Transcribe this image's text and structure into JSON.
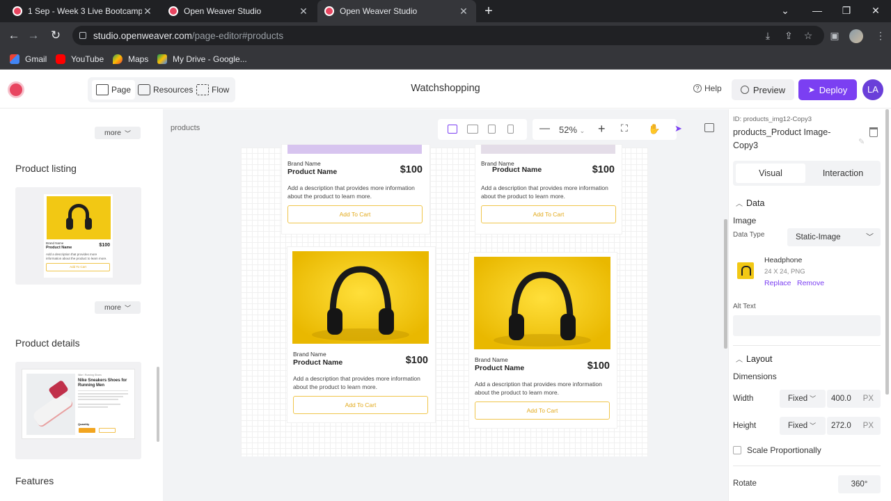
{
  "browser": {
    "tabs": [
      {
        "title": "1 Sep - Week 3 Live Bootcamp / ("
      },
      {
        "title": "Open Weaver Studio"
      },
      {
        "title": "Open Weaver Studio"
      }
    ],
    "url_host": "studio.openweaver.com",
    "url_path": "/page-editor#products",
    "bookmarks": [
      "Gmail",
      "YouTube",
      "Maps",
      "My Drive - Google..."
    ]
  },
  "header": {
    "modes": [
      "Page",
      "Resources",
      "Flow"
    ],
    "title": "Watchshopping",
    "help": "Help",
    "preview": "Preview",
    "deploy": "Deploy",
    "user_initials": "LA"
  },
  "left": {
    "more_label": "more",
    "sections": [
      "Product listing",
      "Product details",
      "Features"
    ],
    "mini_listing": {
      "brand": "Brand Name",
      "name": "Product Name",
      "price": "$100",
      "desc": "Add a description that provides more information about the product to learn more.",
      "cta": "Add To Cart"
    },
    "mini_details": {
      "subtitle": "Nike / Running Shoes",
      "title": "Nike Sneakers Shoes for Running Men",
      "quantity": "Quantity"
    }
  },
  "canvas": {
    "breadcrumb": "products",
    "zoom": "52%",
    "cards": [
      {
        "brand": "Brand Name",
        "name": "Product Name",
        "price": "$100",
        "desc": "Add a description that provides more information about the product to learn more.",
        "cta": "Add To Cart"
      },
      {
        "brand": "Brand Name",
        "name": "Product Name",
        "price": "$100",
        "desc": "Add a description that provides more information about the product to learn more.",
        "cta": "Add To Cart"
      },
      {
        "brand": "Brand Name",
        "name": "Product Name",
        "price": "$100",
        "desc": "Add a description that provides more information about the product to learn more.",
        "cta": "Add To Cart"
      },
      {
        "brand": "Brand Name",
        "name": "Product Name",
        "price": "$100",
        "desc": "Add a description that provides more information about the product to learn more.",
        "cta": "Add To Cart"
      }
    ]
  },
  "right": {
    "id_label": "ID: products_img12-Copy3",
    "name": "products_Product Image-Copy3",
    "tabs": [
      "Visual",
      "Interaction"
    ],
    "data_section": "Data",
    "image_label": "Image",
    "data_type_label": "Data Type",
    "data_type_value": "Static-Image",
    "file_name": "Headphone",
    "file_dims": "24 X 24, PNG",
    "replace": "Replace",
    "remove": "Remove",
    "alt_text": "Alt Text",
    "layout_section": "Layout",
    "dimensions": "Dimensions",
    "width_label": "Width",
    "height_label": "Height",
    "width_mode": "Fixed",
    "height_mode": "Fixed",
    "width_value": "400.0",
    "height_value": "272.0",
    "unit": "PX",
    "scale_label": "Scale Proportionally",
    "rotate_label": "Rotate",
    "rotate_value": "360°"
  }
}
